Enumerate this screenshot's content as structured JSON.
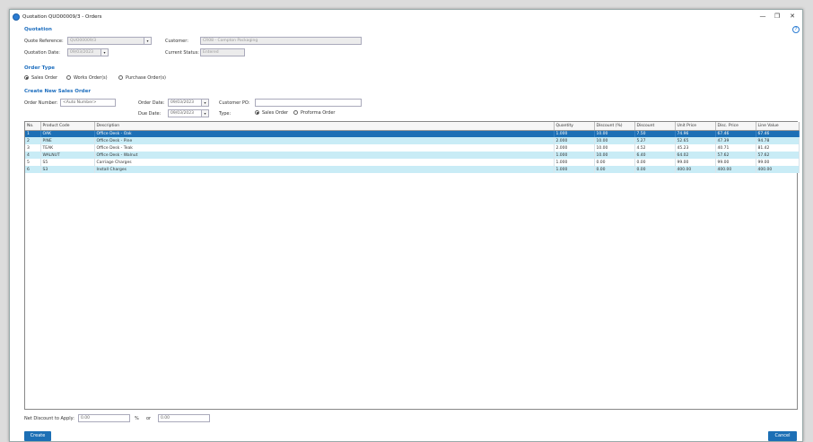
{
  "window": {
    "title": "Quotation QUO00009/3 - Orders",
    "minimize_glyph": "—",
    "restore_glyph": "❐",
    "close_glyph": "✕",
    "help_glyph": "?"
  },
  "quotation": {
    "section_title": "Quotation",
    "quote_reference_label": "Quote Reference:",
    "quote_reference_value": "QUO00009/3",
    "quotation_date_label": "Quotation Date:",
    "quotation_date_value": "09/03/2023",
    "customer_label": "Customer:",
    "customer_value": "CR08 - Compton Packaging",
    "current_status_label": "Current Status:",
    "current_status_value": "Entered"
  },
  "order_type": {
    "section_title": "Order Type",
    "options": [
      "Sales Order",
      "Works Order(s)",
      "Purchase Order(s)"
    ],
    "selected": "Sales Order"
  },
  "new_sales_order": {
    "section_title": "Create New Sales Order",
    "order_number_label": "Order Number:",
    "order_number_value": "<Auto Number>",
    "order_date_label": "Order Date:",
    "order_date_value": "09/03/2023",
    "due_date_label": "Due Date:",
    "due_date_value": "09/03/2023",
    "customer_po_label": "Customer PO:",
    "customer_po_value": "",
    "type_label": "Type:",
    "type_options": [
      "Sales Order",
      "Proforma Order"
    ],
    "type_selected": "Sales Order"
  },
  "table": {
    "columns": [
      "No.",
      "Product Code",
      "Description",
      "Quantity",
      "Discount (%)",
      "Discount",
      "Unit Price",
      "Disc. Price",
      "Line Value"
    ],
    "rows": [
      [
        "1",
        "OAK",
        "Office Desk - Oak",
        "1.000",
        "10.00",
        "7.50",
        "74.96",
        "67.46",
        "67.46"
      ],
      [
        "2",
        "PINE",
        "Office Desk - Pine",
        "2.000",
        "10.00",
        "5.27",
        "52.65",
        "47.39",
        "94.78"
      ],
      [
        "3",
        "TEAK",
        "Office Desk - Teak",
        "2.000",
        "10.00",
        "4.52",
        "45.23",
        "40.71",
        "81.42"
      ],
      [
        "4",
        "WALNUT",
        "Office Desk - Walnut",
        "1.000",
        "10.00",
        "6.40",
        "64.02",
        "57.62",
        "57.62"
      ],
      [
        "5",
        "S5",
        "Carriage Charges",
        "1.000",
        "0.00",
        "0.00",
        "99.00",
        "99.00",
        "99.00"
      ],
      [
        "6",
        "S3",
        "Install Charges",
        "1.000",
        "0.00",
        "0.00",
        "400.00",
        "400.00",
        "400.00"
      ]
    ],
    "selected_row": 0
  },
  "footer": {
    "net_discount_label": "Net Discount to Apply:",
    "net_discount_pct_value": "0.00",
    "pct_symbol": "%",
    "or_label": "or",
    "net_discount_amount_value": "0.00",
    "create_button": "Create",
    "cancel_button": "Cancel"
  },
  "colors": {
    "accent": "#1c6fb5",
    "row_light": "#c9ecf6",
    "section_title": "#1f6fbf"
  }
}
